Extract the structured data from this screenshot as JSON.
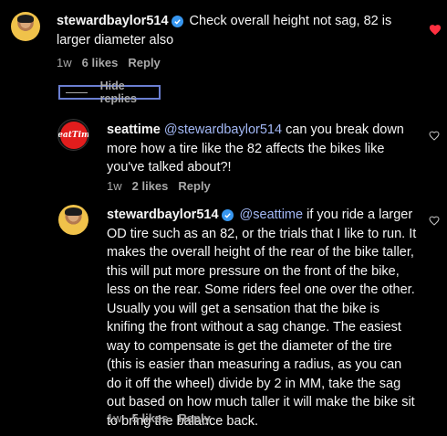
{
  "comments": [
    {
      "username": "stewardbaylor514",
      "text": "Check overall height not sag, 82 is larger diameter also",
      "time": "1w",
      "likes": "6 likes",
      "reply": "Reply",
      "liked": true
    }
  ],
  "hide_replies": "Hide replies",
  "replies": [
    {
      "username": "seattime",
      "mention": "@stewardbaylor514",
      "text": "can you break down more how a tire like the 82 affects the bikes like you've talked about?!",
      "time": "1w",
      "likes": "2 likes",
      "reply": "Reply",
      "avatar_text": "SeatTime"
    },
    {
      "username": "stewardbaylor514",
      "mention": "@seattime",
      "text": "if you ride a larger OD tire such as an 82, or the trials that I like to run. It makes the overall height of the rear of the bike taller, this will put more pressure on the front of the bike, less on the rear. Some riders feel one over the other. Usually you will get a sensation that the bike is knifing the front without a sag change. The easiest way to compensate is get the diameter of the tire (this is easier than measuring a radius, as you can do it off the wheel) divide by 2 in MM, take the sag out based on how much taller it will make the bike sit to bring the balance back.",
      "time": "1w",
      "likes": "5 likes",
      "reply": "Reply"
    }
  ],
  "colors": {
    "heart_liked": "#ff3040",
    "mention": "#a3b8f5",
    "verified": "#3897f0"
  }
}
